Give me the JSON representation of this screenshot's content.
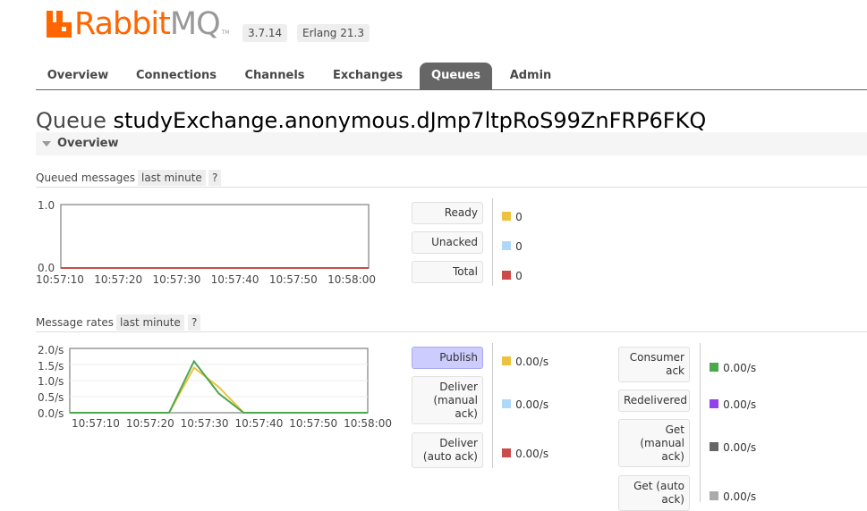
{
  "header": {
    "logo_rabbit": "Rabbit",
    "logo_mq": "MQ",
    "logo_tm": "TM",
    "version": "3.7.14",
    "erlang": "Erlang 21.3"
  },
  "tabs": [
    {
      "label": "Overview",
      "active": false
    },
    {
      "label": "Connections",
      "active": false
    },
    {
      "label": "Channels",
      "active": false
    },
    {
      "label": "Exchanges",
      "active": false
    },
    {
      "label": "Queues",
      "active": true
    },
    {
      "label": "Admin",
      "active": false
    }
  ],
  "page": {
    "title_prefix": "Queue",
    "queue_name": "studyExchange.anonymous.dJmp7ltpRoS99ZnFRP6FKQ",
    "section": "Overview"
  },
  "queued": {
    "label": "Queued messages",
    "period": "last minute",
    "help": "?",
    "yticks": [
      "1.0",
      "0.0"
    ],
    "xticks": [
      "10:57:10",
      "10:57:20",
      "10:57:30",
      "10:57:40",
      "10:57:50",
      "10:58:00"
    ],
    "stats": [
      {
        "label": "Ready",
        "value": "0",
        "color": "#edc240"
      },
      {
        "label": "Unacked",
        "value": "0",
        "color": "#afd8f8"
      },
      {
        "label": "Total",
        "value": "0",
        "color": "#cb4b4b"
      }
    ]
  },
  "rates": {
    "label": "Message rates",
    "period": "last minute",
    "help": "?",
    "yticks": [
      "2.0/s",
      "1.5/s",
      "1.0/s",
      "0.5/s",
      "0.0/s"
    ],
    "xticks": [
      "10:57:10",
      "10:57:20",
      "10:57:30",
      "10:57:40",
      "10:57:50",
      "10:58:00"
    ],
    "left_stats": [
      {
        "label": "Publish",
        "value": "0.00/s",
        "color": "#edc240",
        "highlight": true
      },
      {
        "label": "Deliver (manual ack)",
        "value": "0.00/s",
        "color": "#afd8f8",
        "highlight": false
      },
      {
        "label": "Deliver (auto ack)",
        "value": "0.00/s",
        "color": "#cb4b4b",
        "highlight": false
      }
    ],
    "right_stats": [
      {
        "label": "Consumer ack",
        "value": "0.00/s",
        "color": "#4da74d"
      },
      {
        "label": "Redelivered",
        "value": "0.00/s",
        "color": "#9440ed"
      },
      {
        "label": "Get (manual ack)",
        "value": "0.00/s",
        "color": "#666666"
      },
      {
        "label": "Get (auto ack)",
        "value": "0.00/s",
        "color": "#aaaaaa"
      }
    ]
  },
  "chart_data": [
    {
      "type": "line",
      "title": "Queued messages",
      "x": [
        "10:57:10",
        "10:57:20",
        "10:57:30",
        "10:57:40",
        "10:57:50",
        "10:58:00"
      ],
      "ylim": [
        0,
        1.0
      ],
      "series": [
        {
          "name": "Total",
          "color": "#cb4b4b",
          "values": [
            0,
            0,
            0,
            0,
            0,
            0
          ]
        }
      ]
    },
    {
      "type": "line",
      "title": "Message rates",
      "x_seconds": [
        0,
        10,
        20,
        25,
        30,
        35,
        40,
        50,
        60
      ],
      "xticks": [
        "10:57:10",
        "10:57:20",
        "10:57:30",
        "10:57:40",
        "10:57:50",
        "10:58:00"
      ],
      "ylim": [
        0,
        2.0
      ],
      "series": [
        {
          "name": "Publish",
          "color": "#edc240",
          "values": [
            0,
            0,
            0,
            1.4,
            0.8,
            0,
            0,
            0,
            0
          ]
        },
        {
          "name": "Consumer ack",
          "color": "#4da74d",
          "values": [
            0,
            0,
            0,
            1.6,
            0.6,
            0,
            0,
            0,
            0
          ]
        }
      ]
    }
  ]
}
